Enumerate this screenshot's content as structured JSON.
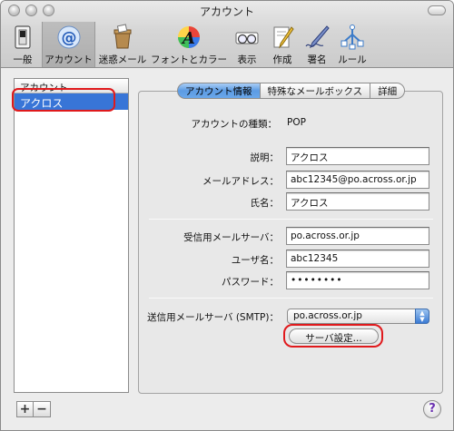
{
  "window": {
    "title": "アカウント"
  },
  "toolbar": {
    "items": [
      {
        "label": "一般",
        "icon": "switch-icon"
      },
      {
        "label": "アカウント",
        "icon": "at-sign-icon",
        "selected": true
      },
      {
        "label": "迷惑メール",
        "icon": "junk-mail-icon"
      },
      {
        "label": "フォントとカラー",
        "icon": "font-color-icon"
      },
      {
        "label": "表示",
        "icon": "glasses-icon"
      },
      {
        "label": "作成",
        "icon": "pencil-paper-icon"
      },
      {
        "label": "署名",
        "icon": "signature-pen-icon"
      },
      {
        "label": "ルール",
        "icon": "rules-icon"
      }
    ]
  },
  "sidebar": {
    "header": "アカウント",
    "accounts": [
      "アクロス"
    ],
    "add_label": "+",
    "remove_label": "−"
  },
  "tabs": [
    "アカウント情報",
    "特殊なメールボックス",
    "詳細"
  ],
  "account": {
    "type_label": "アカウントの種類：",
    "type_value": "POP",
    "description_label": "説明：",
    "description_value": "アクロス",
    "email_label": "メールアドレス：",
    "email_value": "abc12345@po.across.or.jp",
    "name_label": "氏名：",
    "name_value": "アクロス"
  },
  "incoming": {
    "server_label": "受信用メールサーバ：",
    "server_value": "po.across.or.jp",
    "username_label": "ユーザ名：",
    "username_value": "abc12345",
    "password_label": "パスワード：",
    "password_value": "••••••••"
  },
  "outgoing": {
    "smtp_label": "送信用メールサーバ (SMTP)：",
    "smtp_value": "po.across.or.jp",
    "server_settings_button": "サーバ設定..."
  },
  "help": {
    "label": "?"
  },
  "colors": {
    "selection": "#3875d7",
    "highlight_ring": "#e0191c",
    "tab_active": "#6aa7ea"
  }
}
